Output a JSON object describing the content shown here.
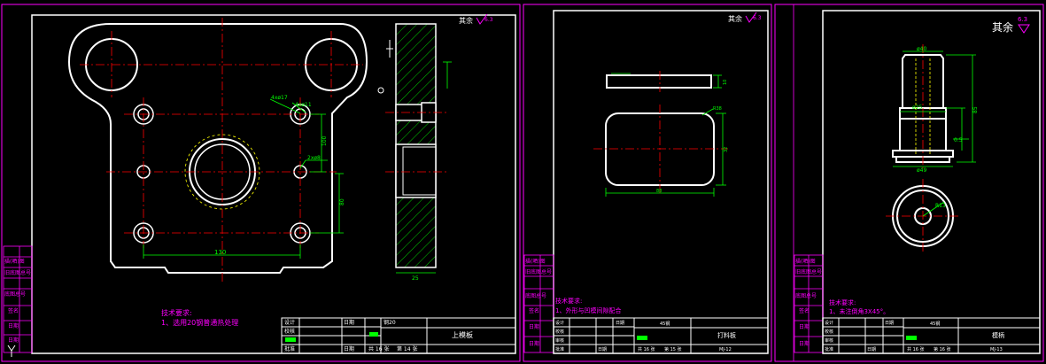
{
  "colors": {
    "background": "#000000",
    "frame": "#ff00ff",
    "outline": "#ffffff",
    "centerline": "#ff0000",
    "dimension": "#00ff00",
    "hidden": "#ffff00",
    "hatch": "#00ff00",
    "note": "#ff00ff"
  },
  "sheets": [
    {
      "roughness": "其余",
      "roughness_value": "6.3",
      "dims": {
        "d_130": "130",
        "hole_4xd17": "4xø17",
        "hole_4xd11": "4xø11",
        "hole_d8": "2xø8",
        "h100": "100",
        "h80": "80",
        "thk": "25"
      },
      "notes": {
        "title": "技术要求:",
        "line1": "1、选用20钢普通热处理"
      },
      "side_labels": [
        "描(晒)图",
        "旧底图总号",
        "底图总号",
        "签名",
        "日期",
        "日期"
      ],
      "title_block": {
        "r1": [
          "设计",
          "",
          "日期",
          "",
          "材料",
          "",
          "上模板"
        ],
        "r2": [
          "校核"
        ],
        "r3": [
          "审核"
        ],
        "r4": [
          "批准",
          "",
          "日期",
          "共 16 张",
          "第 14 张"
        ],
        "part_name": "上模板",
        "material": "钢20",
        "sheet_total": "共 16 张",
        "sheet_no": "第 14 张"
      }
    },
    {
      "roughness": "其余",
      "roughness_value": "6.3",
      "dims": {
        "r": "R38",
        "w": "88",
        "h": "32",
        "t": "10"
      },
      "notes": {
        "title": "技术要求:",
        "line1": "1、外形与凹模间隙配合"
      },
      "side_labels": [
        "描(晒)图",
        "旧底图总号",
        "底图总号",
        "签名",
        "日期",
        "日期"
      ],
      "title_block": {
        "r1": [
          "设计",
          "",
          "日期",
          "",
          "材料"
        ],
        "r2": [
          "校核"
        ],
        "r3": [
          "审核"
        ],
        "r4": [
          "批准",
          "",
          "日期",
          "共 16 张",
          "第 15 张"
        ],
        "part_name": "打料板",
        "material": "45钢",
        "drawing_no": "MJ-12",
        "sheet_total": "共 16 张",
        "sheet_no": "第 15 张"
      }
    },
    {
      "roughness": "其余",
      "roughness_value": "6.3",
      "dims": {
        "d1": "ø40",
        "d2": "ø25",
        "d3": "ø49",
        "h": "85",
        "c": "0.5",
        "r": "R13"
      },
      "notes": {
        "title": "技术要求:",
        "line1": "1、未注倒角3X45°。"
      },
      "side_labels": [
        "描(晒)图",
        "旧底图总号",
        "底图总号",
        "签名",
        "日期",
        "日期"
      ],
      "title_block": {
        "r1": [
          "设计",
          "",
          "日期",
          "",
          "材料"
        ],
        "r2": [
          "校核"
        ],
        "r3": [
          "审核"
        ],
        "r4": [
          "批准",
          "",
          "日期",
          "共 16 张",
          "第 16 张"
        ],
        "part_name": "模柄",
        "material": "45钢",
        "drawing_no": "MJ-13",
        "sheet_total": "共 16 张",
        "sheet_no": "第 16 张"
      }
    }
  ]
}
